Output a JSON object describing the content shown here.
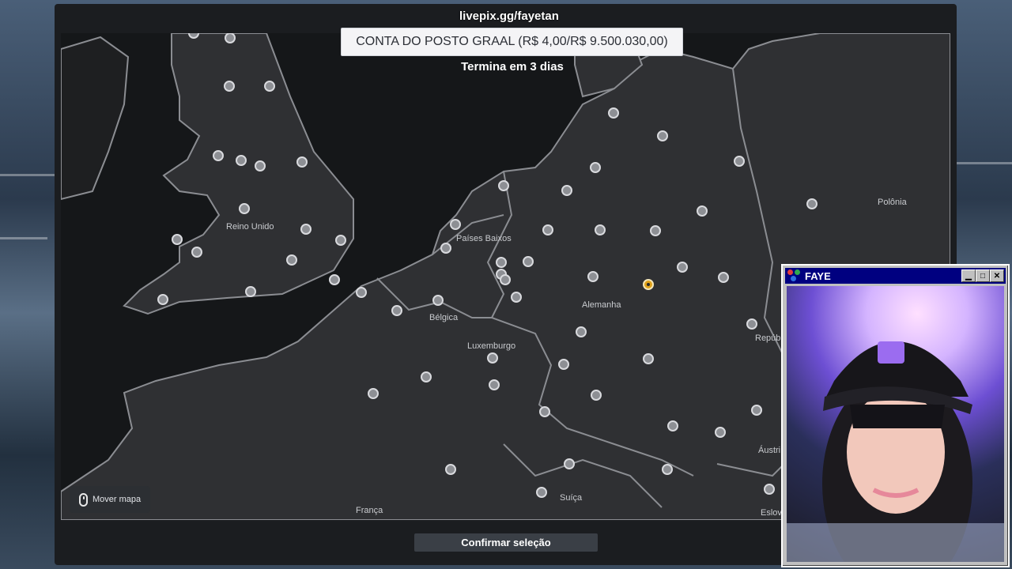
{
  "stream": {
    "watermark": "livepix.gg/fayetan"
  },
  "banner": {
    "account_label": "CONTA DO POSTO GRAAL (R$ 4,00/R$ 9.500.030,00)",
    "ends_in": "Termina em 3 dias"
  },
  "map": {
    "labels": [
      {
        "text": "Reino Unido"
      },
      {
        "text": "Países Baixos"
      },
      {
        "text": "Bélgica"
      },
      {
        "text": "Luxemburgo"
      },
      {
        "text": "Alemanha"
      },
      {
        "text": "Polônia"
      },
      {
        "text": "Repúb"
      },
      {
        "text": "Áustri"
      },
      {
        "text": "Suíça"
      },
      {
        "text": "França"
      },
      {
        "text": "Eslov"
      }
    ],
    "selected_marker_color": "#e0a21a"
  },
  "controls": {
    "move_map_label": "Mover mapa",
    "confirm_label": "Confirmar seleção"
  },
  "webcam": {
    "window_title": "FAYE",
    "buttons": [
      "minimize",
      "maximize",
      "close"
    ]
  },
  "colors": {
    "land": "#2f3033",
    "border": "#8b8d92",
    "marker": "#8d8f94",
    "panel": "#1b1d20"
  }
}
